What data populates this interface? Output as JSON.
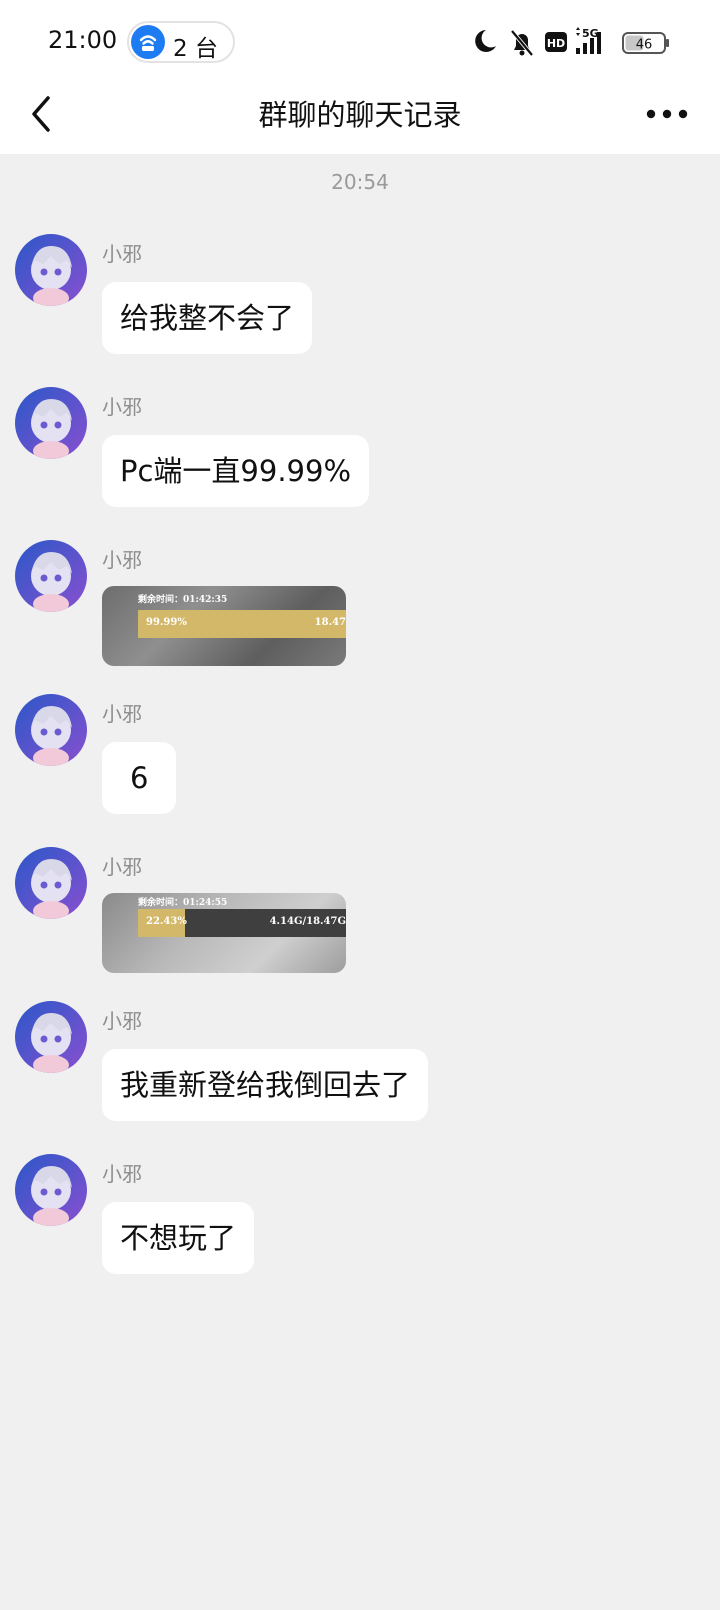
{
  "status_bar": {
    "time": "21:00",
    "hotspot_count": "2 台",
    "network": "5G",
    "hd_label": "HD",
    "battery": "46",
    "icons": [
      "moon-icon",
      "bell-off-icon",
      "hd-icon",
      "signal-icon",
      "battery-icon"
    ]
  },
  "header": {
    "title": "群聊的聊天记录",
    "back_icon": "chevron-left-icon",
    "more_icon": "more-dots-icon"
  },
  "timestamp": "20:54",
  "messages": [
    {
      "sender": "小邪",
      "type": "text",
      "text": "给我整不会了"
    },
    {
      "sender": "小邪",
      "type": "text",
      "text": "Pc端一直99.99%"
    },
    {
      "sender": "小邪",
      "type": "image",
      "caption_time": "剩余时间：01:42:35",
      "percent_text": "99.99%",
      "size_text": "18.47",
      "progress": 0.9999
    },
    {
      "sender": "小邪",
      "type": "text",
      "text": "6"
    },
    {
      "sender": "小邪",
      "type": "image",
      "caption_time": "剩余时间：01:24:55",
      "percent_text": "22.43%",
      "size_text": "4.14G/18.47G",
      "progress": 0.2243
    },
    {
      "sender": "小邪",
      "type": "text",
      "text": "我重新登给我倒回去了"
    },
    {
      "sender": "小邪",
      "type": "text",
      "text": "不想玩了"
    }
  ],
  "colors": {
    "background": "#f0f0f0",
    "bubble": "#ffffff",
    "accent_blue": "#1e7cf2",
    "progress_fill": "#d4b86a"
  }
}
